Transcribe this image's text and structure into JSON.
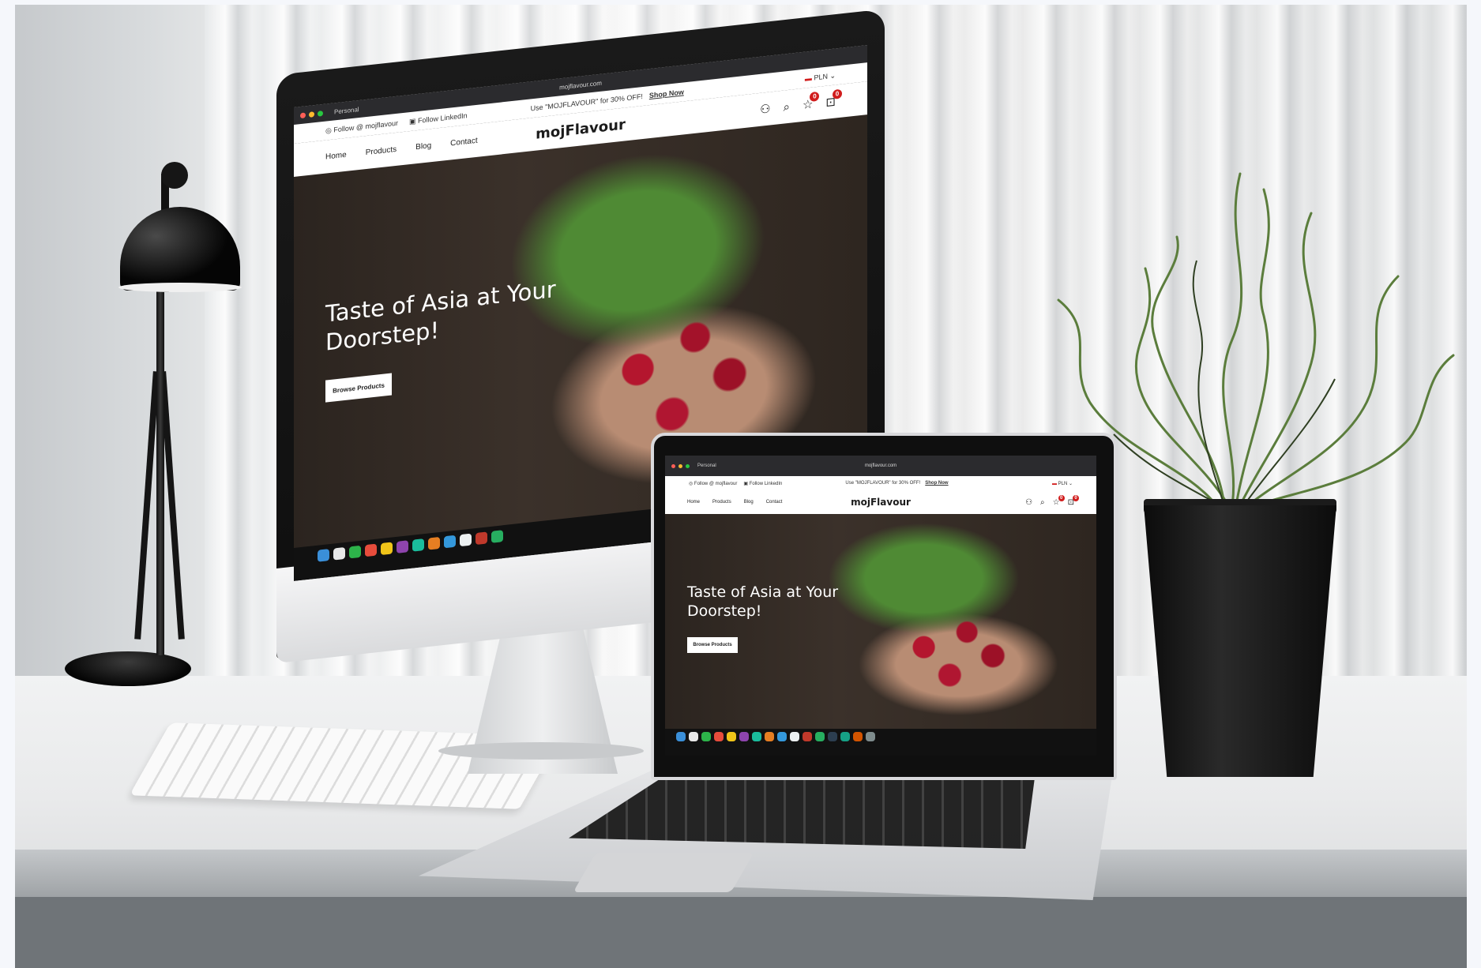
{
  "monitor": {
    "browser": {
      "tab_label": "Personal",
      "url": "mojflavour.com"
    },
    "site": {
      "promo_prefix": "Use \"MOJFLAVOUR\" for 30% OFF!",
      "promo_link": "Shop Now",
      "social_instagram": "Follow @ mojflavour",
      "social_linkedin": "Follow LinkedIn",
      "currency": "PLN",
      "nav": [
        "Home",
        "Products",
        "Blog",
        "Contact"
      ],
      "logo": "mojFlavour",
      "wishlist_count": "0",
      "cart_count": "0",
      "hero_title_line1": "Taste of Asia at Your",
      "hero_title_line2": "Doorstep!",
      "hero_button": "Browse Products"
    }
  },
  "laptop": {
    "browser": {
      "tab_label": "Personal",
      "url": "mojflavour.com"
    },
    "site": {
      "promo_prefix": "Use \"MOJFLAVOUR\" for 30% OFF!",
      "promo_link": "Shop Now",
      "social_instagram": "Follow @ mojflavour",
      "social_linkedin": "Follow LinkedIn",
      "currency": "PLN",
      "nav": [
        "Home",
        "Products",
        "Blog",
        "Contact"
      ],
      "logo": "mojFlavour",
      "wishlist_count": "0",
      "cart_count": "0",
      "hero_title_line1": "Taste of Asia at Your",
      "hero_title_line2": "Doorstep!",
      "hero_button": "Browse Products"
    }
  },
  "colors": {
    "badge": "#d11d1d",
    "hero_dark": "#2b241f",
    "radish": "#b4162e",
    "leaf": "#4f8a34"
  },
  "icons": [
    "user-icon",
    "search-icon",
    "wishlist-icon",
    "cart-icon",
    "instagram-icon",
    "linkedin-icon"
  ]
}
